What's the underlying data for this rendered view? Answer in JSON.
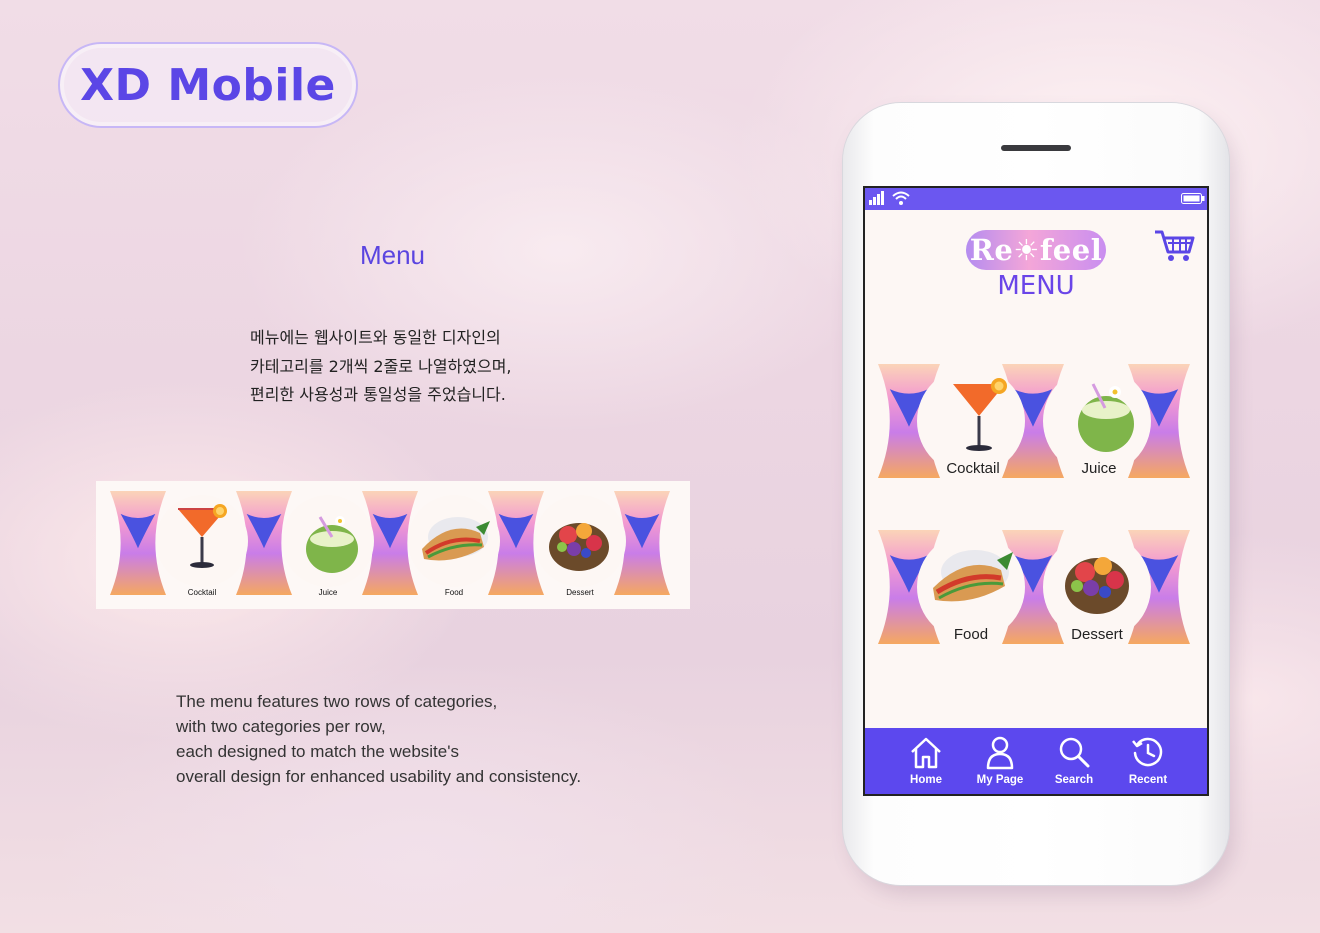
{
  "header": {
    "title": "XD Mobile"
  },
  "section": {
    "title": "Menu",
    "kr_lines": [
      "메뉴에는 웹사이트와 동일한 디자인의",
      "카테고리를 2개씩 2줄로 나열하였으며,",
      "편리한 사용성과 통일성을 주었습니다."
    ],
    "en_lines": [
      "The menu features two rows of categories,",
      "with two categories per row,",
      "each designed to match the website's",
      "overall design for enhanced usability and consistency."
    ]
  },
  "web_strip": {
    "categories": [
      "Cocktail",
      "Juice",
      "Food",
      "Dessert"
    ]
  },
  "app": {
    "logo": "Re☀feel",
    "heading": "MENU",
    "categories": [
      "Cocktail",
      "Juice",
      "Food",
      "Dessert"
    ],
    "nav": [
      "Home",
      "My Page",
      "Search",
      "Recent"
    ]
  },
  "icons": {
    "status": [
      "signal-icon",
      "wifi-icon",
      "battery-icon"
    ],
    "cart": "cart-icon",
    "nav": [
      "home-icon",
      "user-icon",
      "search-icon",
      "recent-icon"
    ],
    "food": [
      "cocktail-icon",
      "coconut-juice-icon",
      "sandwich-icon",
      "fruit-bowl-icon"
    ]
  },
  "colors": {
    "accent": "#5c48ee",
    "title": "#5b46e6",
    "hourglass_top": "#f6b08a",
    "hourglass_mid": "#e86cc0",
    "hourglass_blue": "#4a52e0"
  }
}
